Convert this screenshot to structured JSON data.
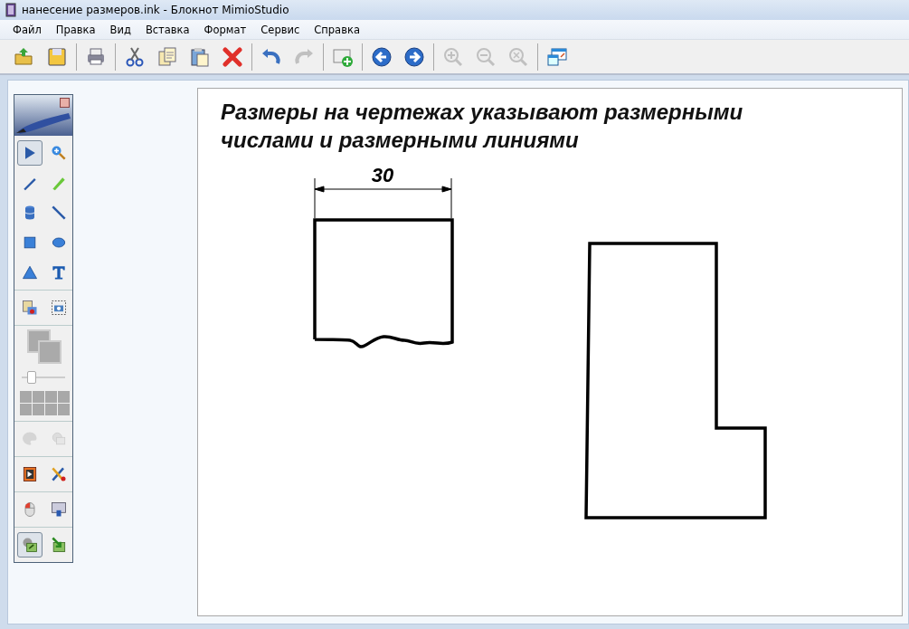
{
  "window": {
    "title": "нанесение размеров.ink - Блокнот MimioStudio"
  },
  "menu": [
    "Файл",
    "Правка",
    "Вид",
    "Вставка",
    "Формат",
    "Сервис",
    "Справка"
  ],
  "toolbar_groups": [
    [
      {
        "disabled": false
      },
      {
        "disabled": false
      }
    ],
    [
      {
        "disabled": false
      }
    ],
    [
      {
        "disabled": false
      },
      {
        "disabled": false
      },
      {
        "disabled": false
      },
      {
        "disabled": false
      }
    ],
    [
      {
        "disabled": false
      },
      {
        "disabled": true
      }
    ],
    [
      {
        "disabled": false
      }
    ],
    [
      {
        "disabled": false
      },
      {
        "disabled": false
      }
    ],
    [
      {
        "disabled": true
      },
      {
        "disabled": true
      },
      {
        "disabled": true
      }
    ],
    [
      {
        "disabled": false
      }
    ]
  ],
  "palette": {
    "tool_groups": [
      [
        {
          "selected": true
        },
        {
          "selected": false
        },
        {
          "selected": false
        },
        {
          "selected": false
        },
        {
          "selected": false
        },
        {
          "selected": false
        },
        {
          "selected": false
        },
        {
          "selected": false
        },
        {
          "selected": false
        },
        {
          "selected": false
        }
      ],
      [
        {
          "selected": false
        },
        {
          "selected": false
        }
      ]
    ],
    "thickness": {
      "level": 0.2
    },
    "lower_groups": [
      [
        {
          "disabled": true
        },
        {
          "disabled": true
        }
      ],
      [
        {
          "disabled": false
        },
        {
          "disabled": false
        }
      ],
      [
        {
          "disabled": false
        },
        {
          "disabled": false
        }
      ],
      [
        {
          "disabled": false,
          "selected": true
        },
        {
          "disabled": false,
          "selected": false
        }
      ]
    ]
  },
  "page": {
    "heading": "Размеры на чертежах указывают размерными числами и размерными линиями",
    "dimension_value": "30"
  }
}
